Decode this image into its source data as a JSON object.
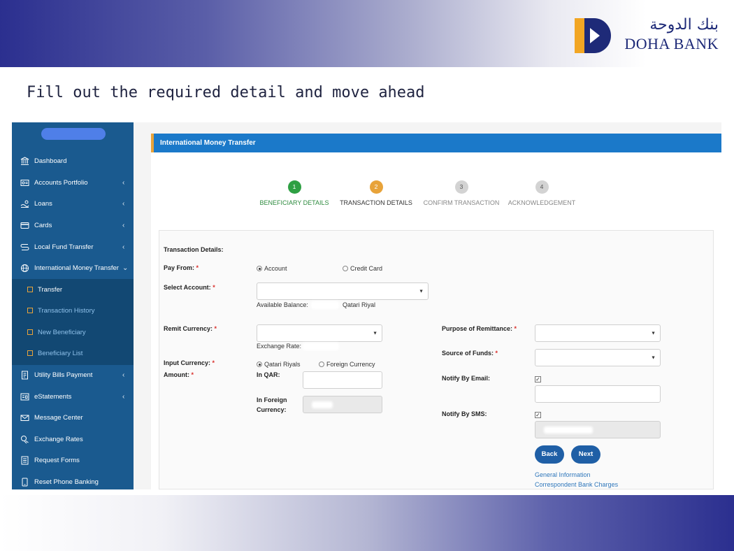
{
  "slide": {
    "heading": "Fill out the required detail and move ahead",
    "colors": {
      "band_dark": "#2b2f8f",
      "sidebar": "#1a5a8f",
      "header_blue": "#1b79c9",
      "accent_orange": "#e8a33a",
      "step_done": "#2ea043"
    }
  },
  "logo": {
    "arabic": "بنك الدوحة",
    "text": "DOHA BANK"
  },
  "sidebar": {
    "items": [
      {
        "label": "Dashboard",
        "icon": "bank-icon",
        "chevron": ""
      },
      {
        "label": "Accounts Portfolio",
        "icon": "portfolio-icon",
        "chevron": "‹"
      },
      {
        "label": "Loans",
        "icon": "loans-icon",
        "chevron": "‹"
      },
      {
        "label": "Cards",
        "icon": "card-icon",
        "chevron": "‹"
      },
      {
        "label": "Local Fund Transfer",
        "icon": "transfer-icon",
        "chevron": "‹"
      },
      {
        "label": "International Money Transfer",
        "icon": "globe-icon",
        "chevron": "⌄"
      }
    ],
    "subitems": [
      {
        "label": "Transfer"
      },
      {
        "label": "Transaction History"
      },
      {
        "label": "New Beneficiary"
      },
      {
        "label": "Beneficiary List"
      }
    ],
    "items_after": [
      {
        "label": "Utility Bills Payment",
        "icon": "bill-icon",
        "chevron": "‹"
      },
      {
        "label": "eStatements",
        "icon": "statement-icon",
        "chevron": "‹"
      },
      {
        "label": "Message Center",
        "icon": "mail-icon",
        "chevron": ""
      },
      {
        "label": "Exchange Rates",
        "icon": "exchange-icon",
        "chevron": ""
      },
      {
        "label": "Request Forms",
        "icon": "form-icon",
        "chevron": ""
      },
      {
        "label": "Reset Phone Banking",
        "icon": "phone-icon",
        "chevron": ""
      }
    ]
  },
  "panel": {
    "title": "International Money Transfer",
    "steps": [
      {
        "num": "1",
        "label": "BENEFICIARY DETAILS",
        "state": "done"
      },
      {
        "num": "2",
        "label": "TRANSACTION DETAILS",
        "state": "current"
      },
      {
        "num": "3",
        "label": "CONFIRM TRANSACTION",
        "state": "pending"
      },
      {
        "num": "4",
        "label": "ACKNOWLEDGEMENT",
        "state": "pending"
      }
    ]
  },
  "form": {
    "section_title": "Transaction Details:",
    "pay_from_label": "Pay From:",
    "pay_from_options": [
      "Account",
      "Credit Card"
    ],
    "select_account_label": "Select Account:",
    "available_balance_label": "Available Balance:",
    "currency_unit": "Qatari Riyal",
    "remit_currency_label": "Remit Currency:",
    "exchange_rate_label": "Exchange Rate:",
    "input_currency_label": "Input Currency:",
    "input_currency_options": [
      "Qatari Riyals",
      "Foreign Currency"
    ],
    "amount_label": "Amount:",
    "in_qar_label": "In QAR:",
    "in_foreign_label_1": "In Foreign",
    "in_foreign_label_2": "Currency:",
    "purpose_label": "Purpose of Remittance:",
    "source_label": "Source of Funds:",
    "notify_email_label": "Notify By Email:",
    "notify_sms_label": "Notify By SMS:",
    "required_mark": "*",
    "back_label": "Back",
    "next_label": "Next",
    "link_general": "General Information",
    "link_charges": "Correspondent Bank Charges"
  }
}
